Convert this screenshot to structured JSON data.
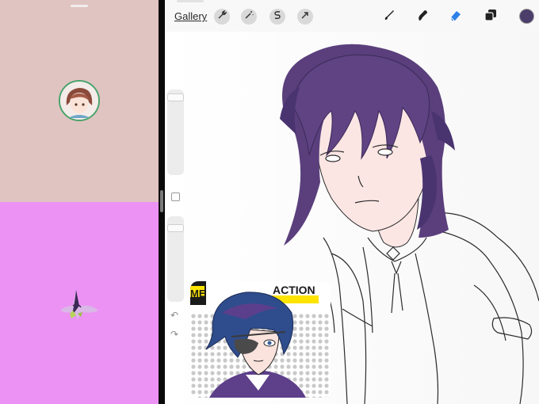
{
  "toolbar": {
    "gallery_label": "Gallery",
    "left_tools": [
      "wrench-icon",
      "magic-wand-icon",
      "selection-s-icon",
      "transform-arrow-icon"
    ],
    "right_tools": [
      "brush-icon",
      "smudge-icon",
      "eraser-icon",
      "layers-icon"
    ],
    "active_tool": "eraser-icon",
    "active_tool_color": "#2f7fe8",
    "current_color": "#4b3e6a"
  },
  "sidebar": {
    "brush_size": 0.95,
    "opacity": 0.9,
    "undo_icon": "undo-arrow-icon",
    "redo_icon": "redo-arrow-icon"
  },
  "left_pane": {
    "top_color": "#dfc4c1",
    "bottom_color": "#ec92f4"
  },
  "reference_window": {
    "label_left": "ME",
    "label_right": "ACTION"
  },
  "colors": {
    "hair": "#5a3f7c",
    "hair_dark": "#3b2a57",
    "skin": "#fbe6e4",
    "line": "#2c2c2c"
  }
}
